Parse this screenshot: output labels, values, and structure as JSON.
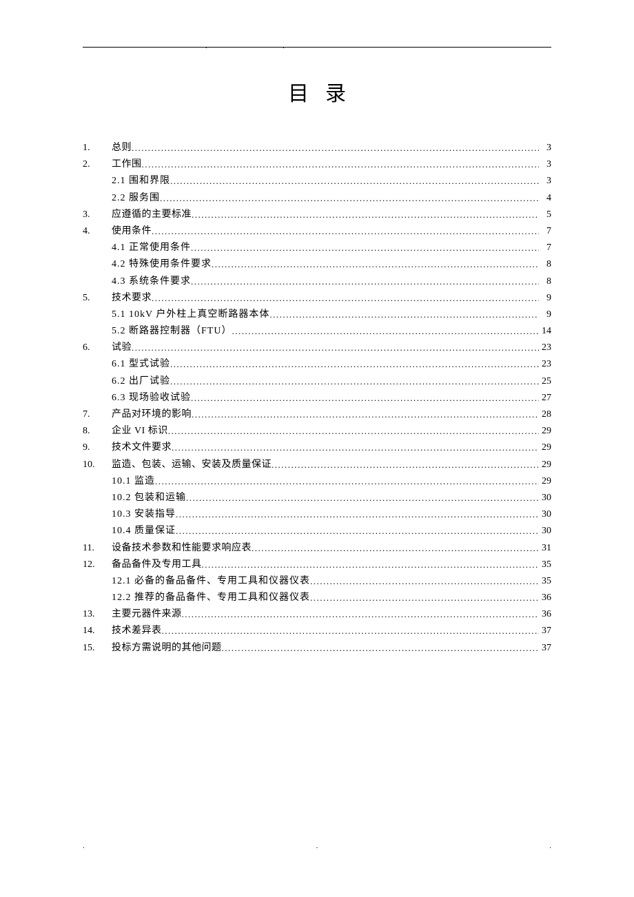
{
  "title": "目录",
  "toc": [
    {
      "num": "1.",
      "text": "总则",
      "page": "3",
      "level": 1
    },
    {
      "num": "2.",
      "text": "工作围",
      "page": "3",
      "level": 1
    },
    {
      "num": "",
      "text": "2.1 围和界限",
      "page": "3",
      "level": 2
    },
    {
      "num": "",
      "text": "2.2 服务围",
      "page": "4",
      "level": 2
    },
    {
      "num": "3.",
      "text": "应遵循的主要标准",
      "page": "5",
      "level": 1
    },
    {
      "num": "4.",
      "text": "使用条件",
      "page": "7",
      "level": 1
    },
    {
      "num": "",
      "text": "4.1 正常使用条件",
      "page": "7",
      "level": 2
    },
    {
      "num": "",
      "text": "4.2 特殊使用条件要求",
      "page": "8",
      "level": 2
    },
    {
      "num": "",
      "text": "4.3 系统条件要求",
      "page": "8",
      "level": 2
    },
    {
      "num": "5.",
      "text": "技术要求",
      "page": "9",
      "level": 1
    },
    {
      "num": "",
      "text": "5.1 10kV 户外柱上真空断路器本体",
      "page": "9",
      "level": 2
    },
    {
      "num": "",
      "text": "5.2 断路器控制器（FTU）",
      "page": "14",
      "level": 2
    },
    {
      "num": "6.",
      "text": "试验",
      "page": "23",
      "level": 1
    },
    {
      "num": "",
      "text": "6.1 型式试验",
      "page": "23",
      "level": 2
    },
    {
      "num": "",
      "text": "6.2 出厂试验",
      "page": "25",
      "level": 2
    },
    {
      "num": "",
      "text": "6.3 现场验收试验",
      "page": "27",
      "level": 2
    },
    {
      "num": "7.",
      "text": "产品对环境的影响",
      "page": "28",
      "level": 1
    },
    {
      "num": "8.",
      "text": "企业 VI 标识",
      "page": "29",
      "level": 1
    },
    {
      "num": "9.",
      "text": "技术文件要求",
      "page": "29",
      "level": 1
    },
    {
      "num": "10.",
      "text": "监造、包装、运输、安装及质量保证",
      "page": "29",
      "level": 1
    },
    {
      "num": "",
      "text": "10.1 监造",
      "page": "29",
      "level": 2
    },
    {
      "num": "",
      "text": "10.2 包装和运输",
      "page": "30",
      "level": 2
    },
    {
      "num": "",
      "text": "10.3 安装指导",
      "page": "30",
      "level": 2
    },
    {
      "num": "",
      "text": "10.4 质量保证",
      "page": "30",
      "level": 2
    },
    {
      "num": "11.",
      "text": "设备技术参数和性能要求响应表",
      "page": "31",
      "level": 1
    },
    {
      "num": "12.",
      "text": "备品备件及专用工具",
      "page": "35",
      "level": 1
    },
    {
      "num": "",
      "text": "12.1 必备的备品备件、专用工具和仪器仪表",
      "page": "35",
      "level": 2
    },
    {
      "num": "",
      "text": "12.2 推荐的备品备件、专用工具和仪器仪表",
      "page": "36",
      "level": 2
    },
    {
      "num": "13.",
      "text": "主要元器件来源",
      "page": "36",
      "level": 1
    },
    {
      "num": "14.",
      "text": "技术差异表",
      "page": "37",
      "level": 1
    },
    {
      "num": "15.",
      "text": "投标方需说明的其他问题",
      "page": "37",
      "level": 1
    }
  ]
}
